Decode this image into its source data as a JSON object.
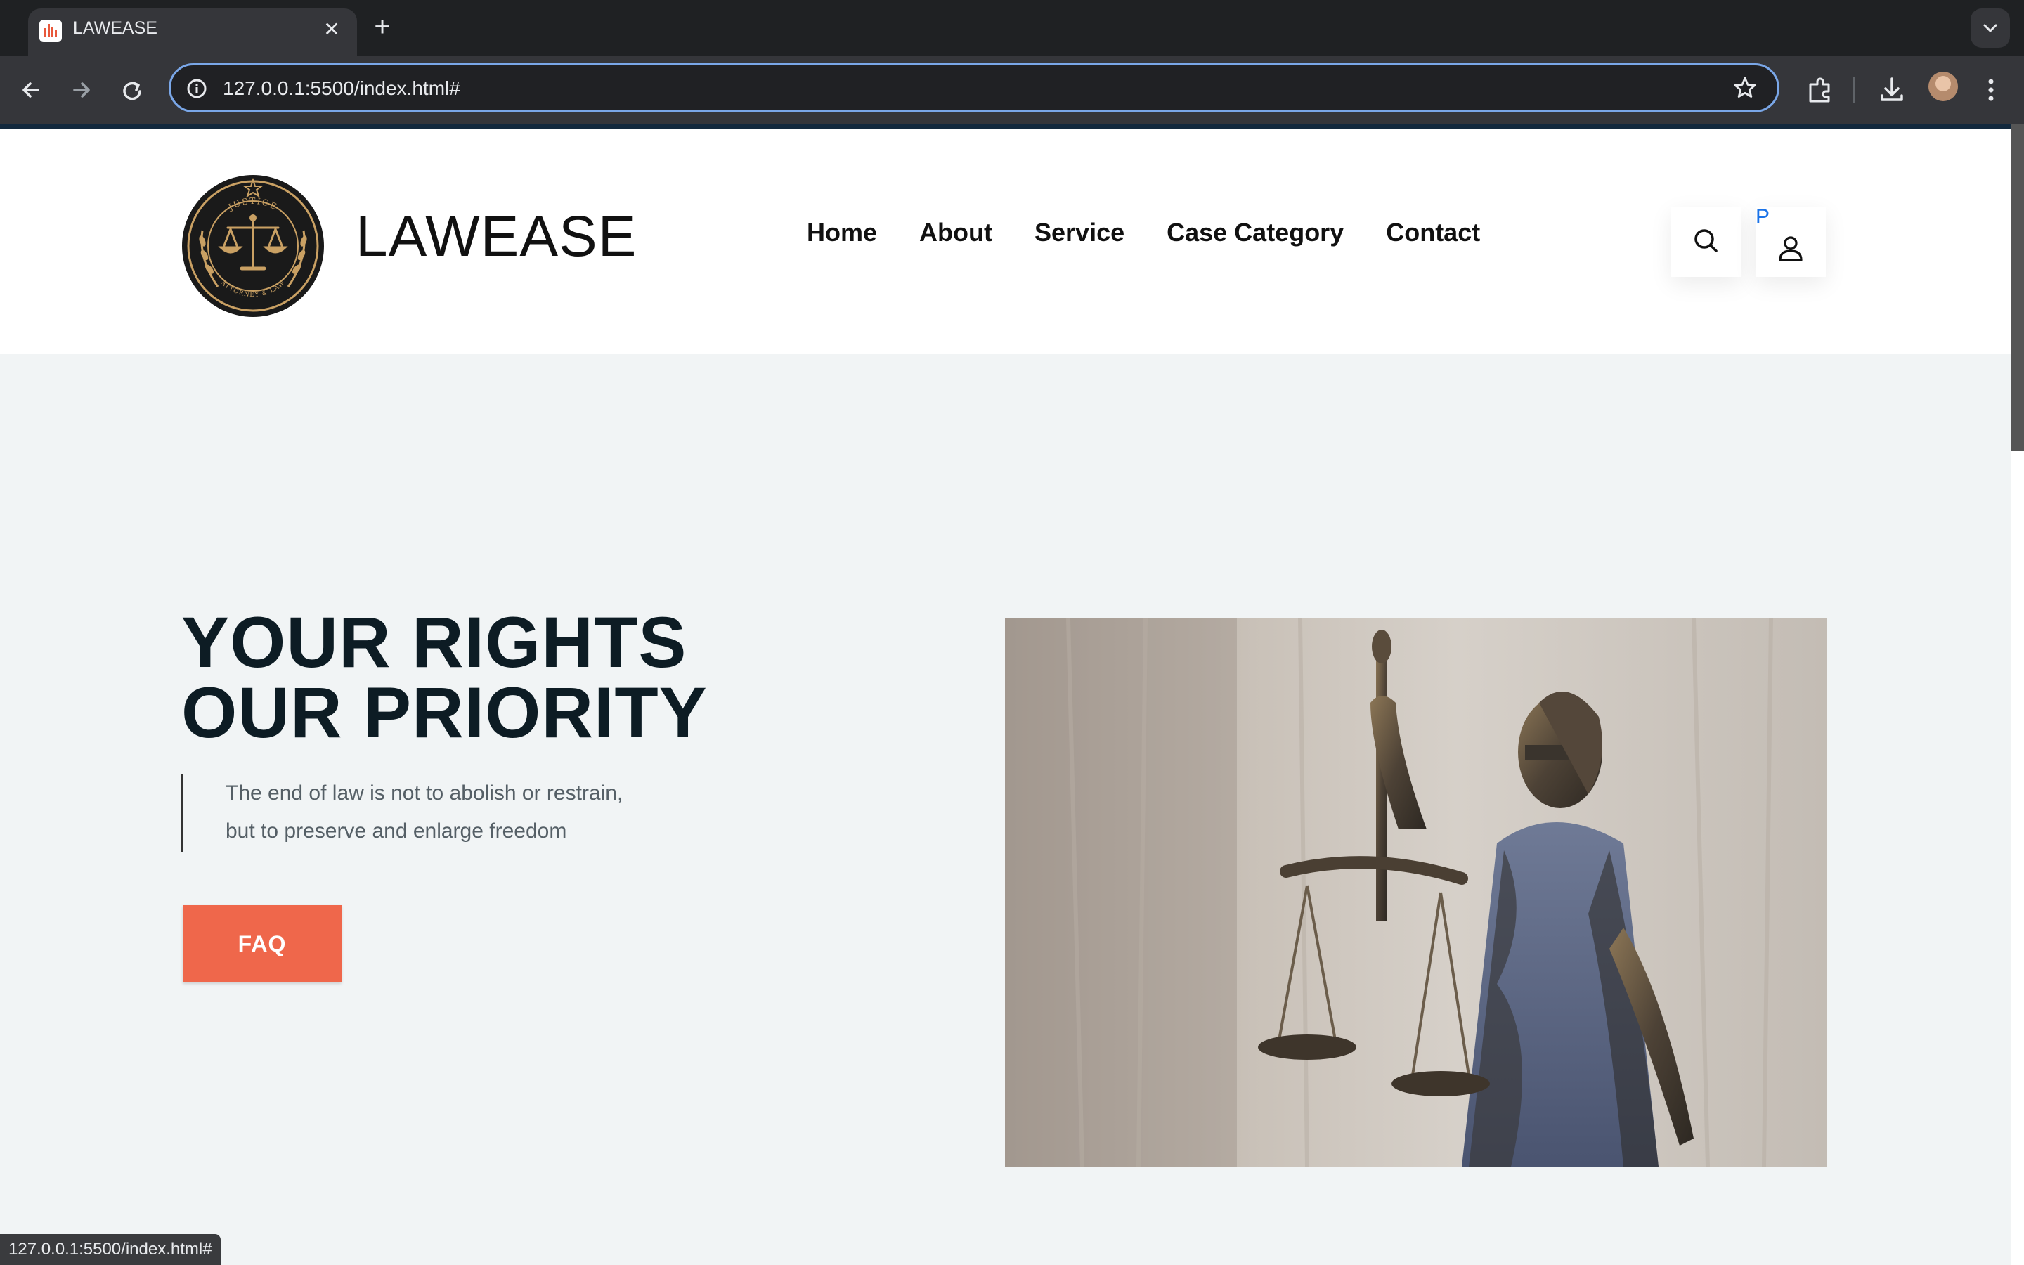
{
  "browser": {
    "tab_title": "LAWEASE",
    "tab_close": "✕",
    "new_tab": "+",
    "url": "127.0.0.1:5500/index.html#",
    "status_url": "127.0.0.1:5500/index.html#"
  },
  "site": {
    "brand": "LAWEASE",
    "logo_ring_top": "JUSTICE",
    "logo_ring_bottom": "ATTORNEY & LAW",
    "nav": [
      "Home",
      "About",
      "Service",
      "Case Category",
      "Contact"
    ],
    "user_letter": "P"
  },
  "hero": {
    "title_line1": "YOUR RIGHTS",
    "title_line2": "OUR PRIORITY",
    "quote_line1": "The end of law is not to abolish or restrain,",
    "quote_line2": "but to preserve and enlarge freedom",
    "cta": "FAQ"
  },
  "colors": {
    "accent": "#ef674b",
    "hero_bg": "#f1f4f5",
    "brand_text": "#111111",
    "logo_gold": "#c9a063"
  }
}
